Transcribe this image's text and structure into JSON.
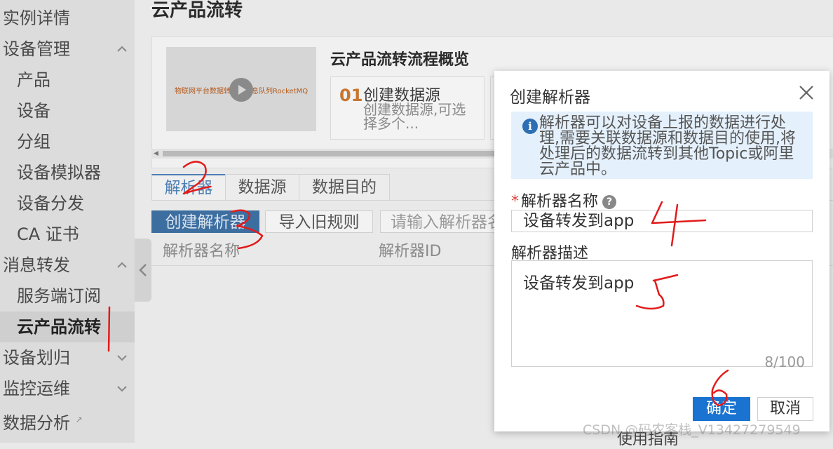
{
  "sidebar": {
    "items": [
      {
        "label": "实例详情",
        "level": "top"
      },
      {
        "label": "设备管理",
        "level": "top",
        "chevron": "up"
      },
      {
        "label": "产品",
        "level": "sub"
      },
      {
        "label": "设备",
        "level": "sub"
      },
      {
        "label": "分组",
        "level": "sub"
      },
      {
        "label": "设备模拟器",
        "level": "sub"
      },
      {
        "label": "设备分发",
        "level": "sub"
      },
      {
        "label": "CA 证书",
        "level": "sub"
      },
      {
        "label": "消息转发",
        "level": "top",
        "chevron": "up"
      },
      {
        "label": "服务端订阅",
        "level": "sub"
      },
      {
        "label": "云产品流转",
        "level": "sub",
        "active": true
      },
      {
        "label": "设备划归",
        "level": "top",
        "chevron": "down"
      },
      {
        "label": "监控运维",
        "level": "top",
        "chevron": "down"
      },
      {
        "label": "数据分析",
        "level": "top",
        "external": true
      }
    ]
  },
  "main": {
    "page_title": "云产品流转",
    "overview": {
      "title": "云产品流转流程概览",
      "video_caption": "物联网平台数据转发到消息队列RocketMQ",
      "steps": [
        {
          "num": "01",
          "title": "创建数据源",
          "desc": "创建数据源,可选择多个..."
        }
      ]
    },
    "tabs": [
      "解析器",
      "数据源",
      "数据目的"
    ],
    "toolbar": {
      "create": "创建解析器",
      "import": "导入旧规则",
      "search_placeholder": "请输入解析器名称"
    },
    "table_headers": [
      "解析器名称",
      "解析器ID"
    ],
    "guide": "使用指南"
  },
  "dialog": {
    "title": "创建解析器",
    "info": "解析器可以对设备上报的数据进行处理,需要关联数据源和数据目的使用,将处理后的数据流转到其他Topic或阿里云产品中。",
    "name_label": "解析器名称",
    "name_value": "设备转发到app",
    "desc_label": "解析器描述",
    "desc_value": "设备转发到app",
    "counter": "8/100",
    "ok": "确定",
    "cancel": "取消"
  },
  "watermark": "CSDN @码农客栈_V13427279549",
  "colors": {
    "primary": "#1a73d1",
    "annotation": "#e21b1b",
    "required": "#d9453a"
  }
}
